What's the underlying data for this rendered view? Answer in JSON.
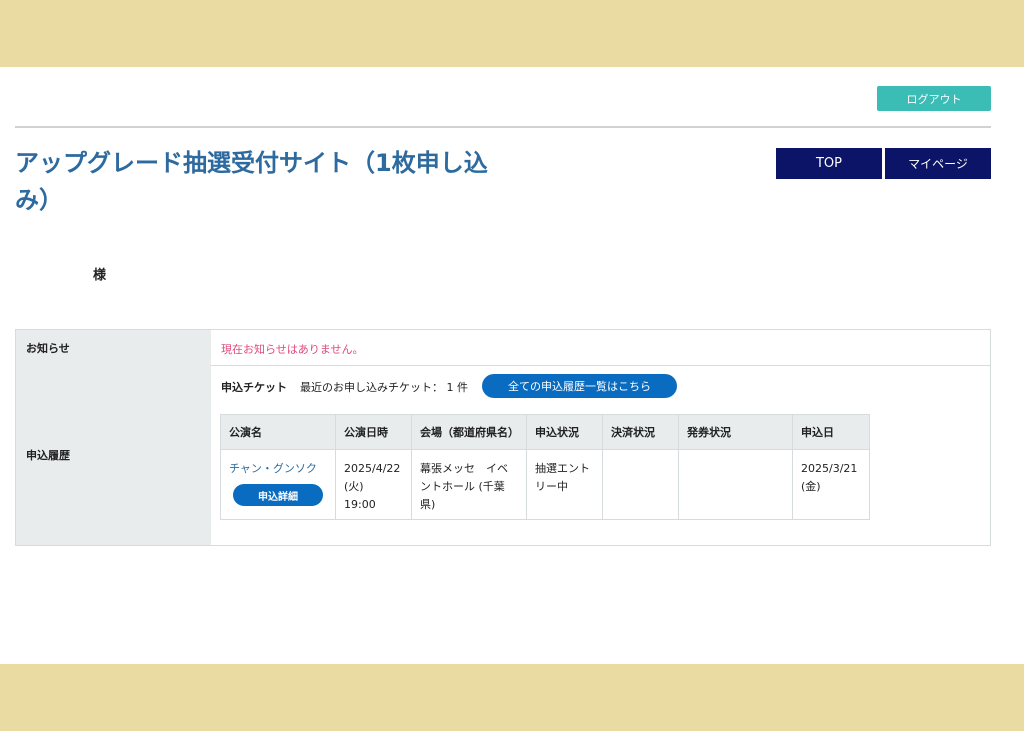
{
  "header": {
    "logout_label": "ログアウト",
    "title": "アップグレード抽選受付サイト（1枚申し込み）",
    "nav": {
      "top_label": "TOP",
      "mypage_label": "マイページ"
    }
  },
  "user": {
    "suffix": "様"
  },
  "notice": {
    "label": "お知らせ",
    "message": "現在お知らせはありません。"
  },
  "history": {
    "label": "申込履歴",
    "ticket_label": "申込チケット",
    "recent_count_text": "最近のお申し込みチケット： 1 件",
    "all_history_button": "全ての申込履歴一覧はこちら",
    "columns": [
      "公演名",
      "公演日時",
      "会場（都道府県名）",
      "申込状況",
      "決済状況",
      "発券状況",
      "申込日"
    ],
    "rows": [
      {
        "event_name": "チャン・グンソク",
        "detail_button": "申込詳細",
        "event_date": "2025/4/22",
        "event_weekday": "(火)",
        "event_time": "19:00",
        "venue": "幕張メッセ　イベントホール (千葉県)",
        "status": "抽選エントリー中",
        "payment": "",
        "ticketing": "",
        "apply_date": "2025/3/21",
        "apply_weekday": "(金)"
      }
    ]
  },
  "colors": {
    "band": "#e9dba1",
    "title": "#2d6a9f",
    "logout": "#3bbdb5",
    "nav": "#0b1466",
    "pill": "#0a6cc0",
    "notice_text": "#e2497b"
  }
}
